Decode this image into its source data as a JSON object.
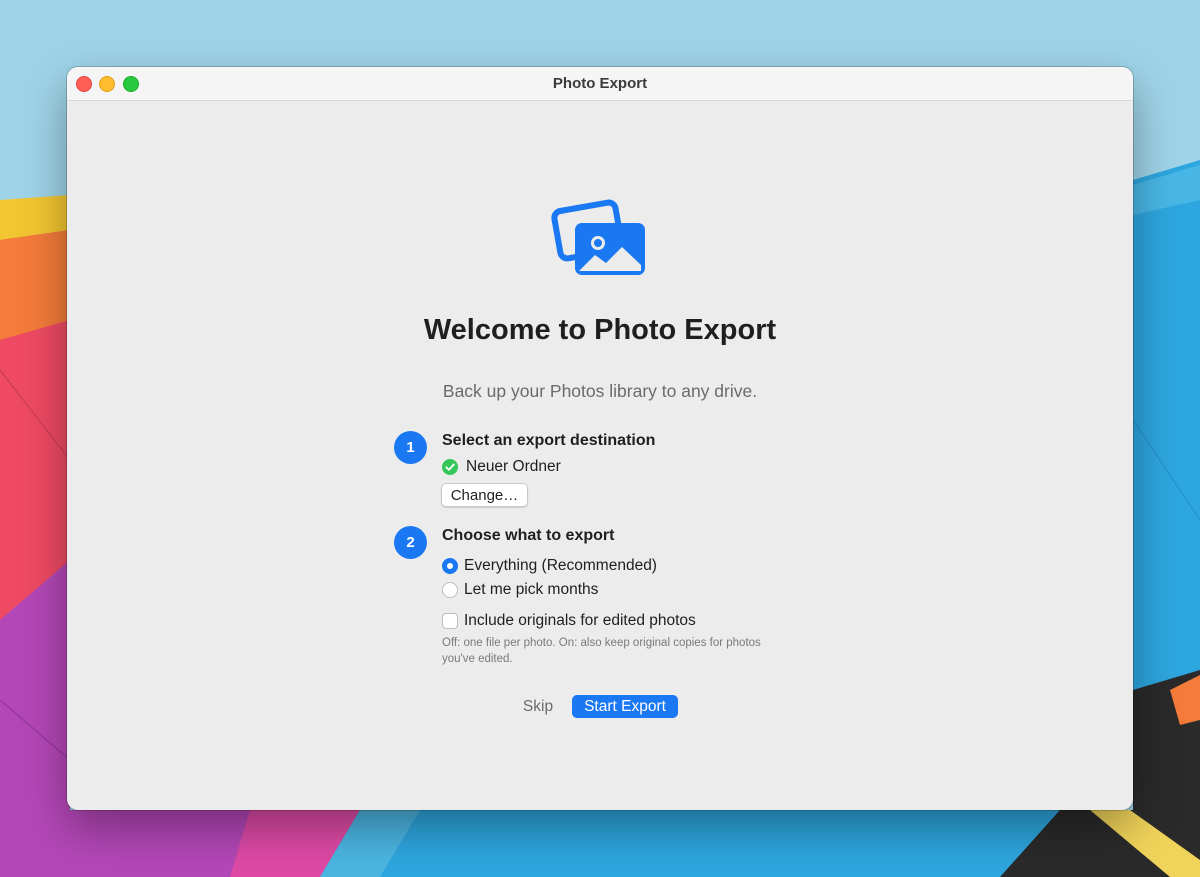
{
  "window": {
    "title": "Photo Export"
  },
  "welcome": {
    "icon": "photos-stack-icon",
    "heading": "Welcome to Photo Export",
    "subtitle": "Back up your Photos library to any drive."
  },
  "steps": [
    {
      "number": "1",
      "title": "Select an export destination",
      "destination_label": "Neuer Ordner",
      "change_button": "Change…"
    },
    {
      "number": "2",
      "title": "Choose what to export",
      "options": [
        {
          "label": "Everything (Recommended)",
          "selected": true
        },
        {
          "label": "Let me pick months",
          "selected": false
        }
      ],
      "include_originals": {
        "label": "Include originals for edited photos",
        "checked": false,
        "hint_line1": "Off: one file per photo. On: also keep original copies for photos",
        "hint_line2": "you've edited."
      }
    }
  ],
  "actions": {
    "skip": "Skip",
    "start": "Start Export"
  },
  "colors": {
    "accent": "#1a78f2",
    "success": "#34c759",
    "window_bg": "#ececec"
  }
}
